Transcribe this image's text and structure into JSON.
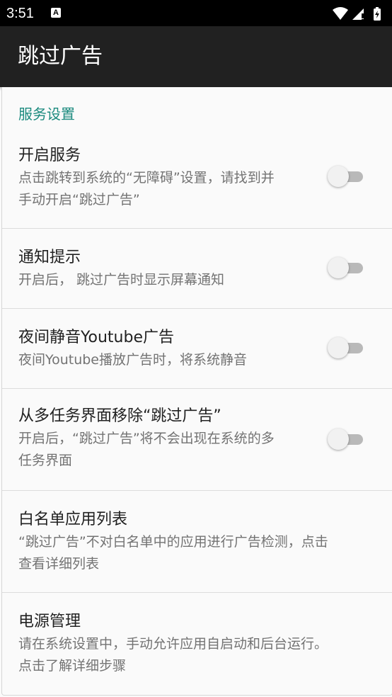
{
  "status_bar": {
    "time": "3:51",
    "notification_icon_letter": "A"
  },
  "app_bar": {
    "title": "跳过广告"
  },
  "settings": {
    "category": "服务设置",
    "items": [
      {
        "title": "开启服务",
        "summary": "点击跳转到系统的“无障碍”设置，请找到并\n手动开启“跳过广告”",
        "switch": "off"
      },
      {
        "title": "通知提示",
        "summary": "开启后， 跳过广告时显示屏幕通知",
        "switch": "off"
      },
      {
        "title": "夜间静音Youtube广告",
        "summary": "夜间Youtube播放广告时，将系统静音",
        "switch": "off"
      },
      {
        "title": "从多任务界面移除“跳过广告”",
        "summary": "开启后，“跳过广告”将不会出现在系统的多\n任务界面",
        "switch": "off"
      },
      {
        "title": "白名单应用列表",
        "summary": "“跳过广告”不对白名单中的应用进行广告检测，点击\n查看详细列表"
      },
      {
        "title": "电源管理",
        "summary": "请在系统设置中，手动允许应用自启动和后台运行。\n点击了解详细步骤"
      }
    ]
  },
  "colors": {
    "status_bar": "#000000",
    "app_bar": "#212121",
    "accent": "#1b8a7e",
    "background": "#fafafa",
    "switch_track_off": "#b9b9b9",
    "switch_thumb_off": "#f1f1f1"
  }
}
